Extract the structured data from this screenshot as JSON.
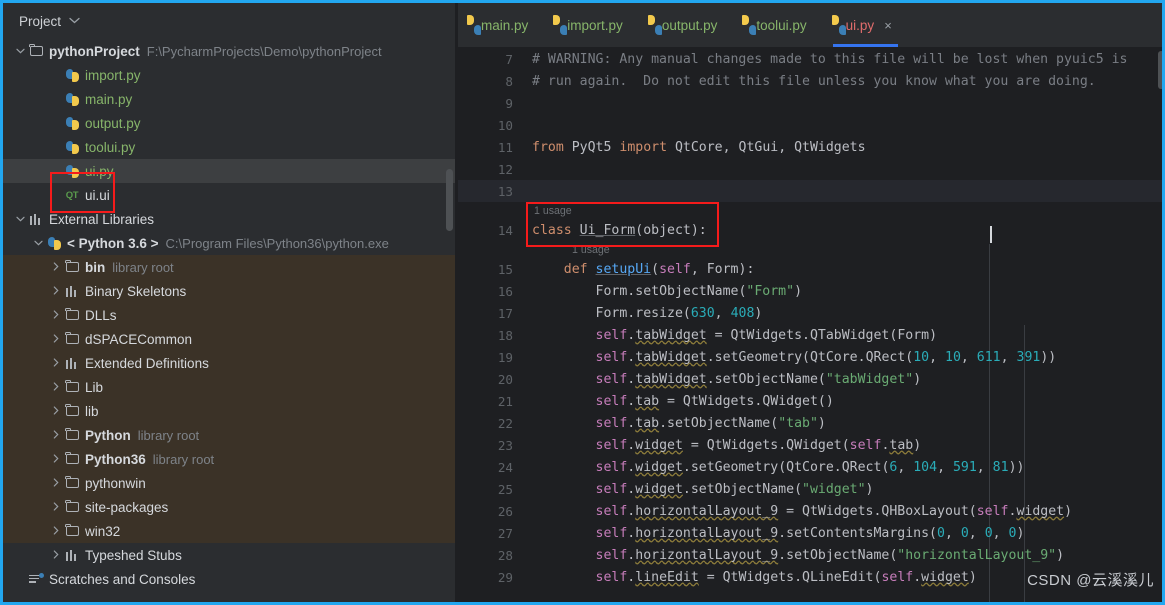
{
  "window": {
    "accent_color": "#22a7f0",
    "sidebar_bg": "#2b2d30",
    "editor_bg": "#1e1f22",
    "library_highlight": "#3b3227",
    "annotation_color": "#f51b1b"
  },
  "sidebar": {
    "title": "Project",
    "caret_icon": "chevron-down-icon",
    "tree": [
      {
        "label": "pythonProject",
        "hint": "F:\\PycharmProjects\\Demo\\pythonProject",
        "icon": "folder-icon",
        "arrow": "chevron-down-icon",
        "indent": 0,
        "bold": true,
        "style": "plain"
      },
      {
        "label": "import.py",
        "hint": "",
        "icon": "python-file-icon",
        "arrow": "",
        "indent": 2,
        "bold": false,
        "style": "py"
      },
      {
        "label": "main.py",
        "hint": "",
        "icon": "python-file-icon",
        "arrow": "",
        "indent": 2,
        "bold": false,
        "style": "py"
      },
      {
        "label": "output.py",
        "hint": "",
        "icon": "python-file-icon",
        "arrow": "",
        "indent": 2,
        "bold": false,
        "style": "py"
      },
      {
        "label": "toolui.py",
        "hint": "",
        "icon": "python-file-icon",
        "arrow": "",
        "indent": 2,
        "bold": false,
        "style": "py"
      },
      {
        "label": "ui.py",
        "hint": "",
        "icon": "python-file-icon",
        "arrow": "",
        "indent": 2,
        "bold": false,
        "style": "py",
        "selected": true
      },
      {
        "label": "ui.ui",
        "hint": "",
        "icon": "qt-designer-icon",
        "arrow": "",
        "indent": 2,
        "bold": false,
        "style": "ui"
      },
      {
        "label": "External Libraries",
        "hint": "",
        "icon": "library-icon",
        "arrow": "chevron-down-icon",
        "indent": 0,
        "bold": false,
        "style": "plain"
      },
      {
        "label": "< Python 3.6 >",
        "hint": "C:\\Program Files\\Python36\\python.exe",
        "icon": "python-interpreter-icon",
        "arrow": "chevron-down-icon",
        "indent": 1,
        "bold": true,
        "style": "plain"
      },
      {
        "label": "bin",
        "hint": "library root",
        "icon": "folder-icon",
        "arrow": "chevron-right-icon",
        "indent": 2,
        "bold": true,
        "style": "plain",
        "lib": true
      },
      {
        "label": "Binary Skeletons",
        "hint": "",
        "icon": "library-icon",
        "arrow": "chevron-right-icon",
        "indent": 2,
        "bold": false,
        "style": "plain",
        "lib": true
      },
      {
        "label": "DLLs",
        "hint": "",
        "icon": "folder-icon",
        "arrow": "chevron-right-icon",
        "indent": 2,
        "bold": false,
        "style": "plain",
        "lib": true
      },
      {
        "label": "dSPACECommon",
        "hint": "",
        "icon": "folder-icon",
        "arrow": "chevron-right-icon",
        "indent": 2,
        "bold": false,
        "style": "plain",
        "lib": true
      },
      {
        "label": "Extended Definitions",
        "hint": "",
        "icon": "library-icon",
        "arrow": "chevron-right-icon",
        "indent": 2,
        "bold": false,
        "style": "plain",
        "lib": true
      },
      {
        "label": "Lib",
        "hint": "",
        "icon": "folder-icon",
        "arrow": "chevron-right-icon",
        "indent": 2,
        "bold": false,
        "style": "plain",
        "lib": true
      },
      {
        "label": "lib",
        "hint": "",
        "icon": "folder-icon",
        "arrow": "chevron-right-icon",
        "indent": 2,
        "bold": false,
        "style": "plain",
        "lib": true
      },
      {
        "label": "Python",
        "hint": "library root",
        "icon": "folder-icon",
        "arrow": "chevron-right-icon",
        "indent": 2,
        "bold": true,
        "style": "plain",
        "lib": true
      },
      {
        "label": "Python36",
        "hint": "library root",
        "icon": "folder-icon",
        "arrow": "chevron-right-icon",
        "indent": 2,
        "bold": true,
        "style": "plain",
        "lib": true
      },
      {
        "label": "pythonwin",
        "hint": "",
        "icon": "folder-icon",
        "arrow": "chevron-right-icon",
        "indent": 2,
        "bold": false,
        "style": "plain",
        "lib": true
      },
      {
        "label": "site-packages",
        "hint": "",
        "icon": "folder-icon",
        "arrow": "chevron-right-icon",
        "indent": 2,
        "bold": false,
        "style": "plain",
        "lib": true
      },
      {
        "label": "win32",
        "hint": "",
        "icon": "folder-icon",
        "arrow": "chevron-right-icon",
        "indent": 2,
        "bold": false,
        "style": "plain",
        "lib": true
      },
      {
        "label": "Typeshed Stubs",
        "hint": "",
        "icon": "library-icon",
        "arrow": "chevron-right-icon",
        "indent": 2,
        "bold": false,
        "style": "plain"
      },
      {
        "label": "Scratches and Consoles",
        "hint": "",
        "icon": "scratches-icon",
        "arrow": "",
        "indent": 0,
        "bold": false,
        "style": "plain"
      }
    ]
  },
  "editor": {
    "tabs": [
      {
        "label": "main.py",
        "icon": "python-file-icon",
        "active": false,
        "closable": false
      },
      {
        "label": "import.py",
        "icon": "python-file-icon",
        "active": false,
        "closable": false
      },
      {
        "label": "output.py",
        "icon": "python-file-icon",
        "active": false,
        "closable": false
      },
      {
        "label": "toolui.py",
        "icon": "python-file-icon",
        "active": false,
        "closable": false
      },
      {
        "label": "ui.py",
        "icon": "python-file-icon",
        "active": true,
        "closable": true,
        "close_icon": "close-icon",
        "close_label": "×"
      }
    ],
    "usage_hint_class": "1 usage",
    "usage_hint_method": "1 usage",
    "lines": [
      {
        "num": "7",
        "text": "# WARNING: Any manual changes made to this file will be lost when pyuic5 is"
      },
      {
        "num": "8",
        "text": "# run again.  Do not edit this file unless you know what you are doing."
      },
      {
        "num": "9",
        "text": ""
      },
      {
        "num": "10",
        "text": ""
      },
      {
        "num": "11",
        "text": "from PyQt5 import QtCore, QtGui, QtWidgets"
      },
      {
        "num": "12",
        "text": ""
      },
      {
        "num": "13",
        "text": ""
      },
      {
        "num": "14",
        "text": "class Ui_Form(object):"
      },
      {
        "num": "15",
        "text": "    def setupUi(self, Form):"
      },
      {
        "num": "16",
        "text": "        Form.setObjectName(\"Form\")"
      },
      {
        "num": "17",
        "text": "        Form.resize(630, 408)"
      },
      {
        "num": "18",
        "text": "        self.tabWidget = QtWidgets.QTabWidget(Form)"
      },
      {
        "num": "19",
        "text": "        self.tabWidget.setGeometry(QtCore.QRect(10, 10, 611, 391))"
      },
      {
        "num": "20",
        "text": "        self.tabWidget.setObjectName(\"tabWidget\")"
      },
      {
        "num": "21",
        "text": "        self.tab = QtWidgets.QWidget()"
      },
      {
        "num": "22",
        "text": "        self.tab.setObjectName(\"tab\")"
      },
      {
        "num": "23",
        "text": "        self.widget = QtWidgets.QWidget(self.tab)"
      },
      {
        "num": "24",
        "text": "        self.widget.setGeometry(QtCore.QRect(6, 104, 591, 81))"
      },
      {
        "num": "25",
        "text": "        self.widget.setObjectName(\"widget\")"
      },
      {
        "num": "26",
        "text": "        self.horizontalLayout_9 = QtWidgets.QHBoxLayout(self.widget)"
      },
      {
        "num": "27",
        "text": "        self.horizontalLayout_9.setContentsMargins(0, 0, 0, 0)"
      },
      {
        "num": "28",
        "text": "        self.horizontalLayout_9.setObjectName(\"horizontalLayout_9\")"
      },
      {
        "num": "29",
        "text": "        self.lineEdit = QtWidgets.QLineEdit(self.widget)"
      }
    ],
    "current_line": "13"
  },
  "watermark": {
    "text": "CSDN @云溪溪儿"
  }
}
